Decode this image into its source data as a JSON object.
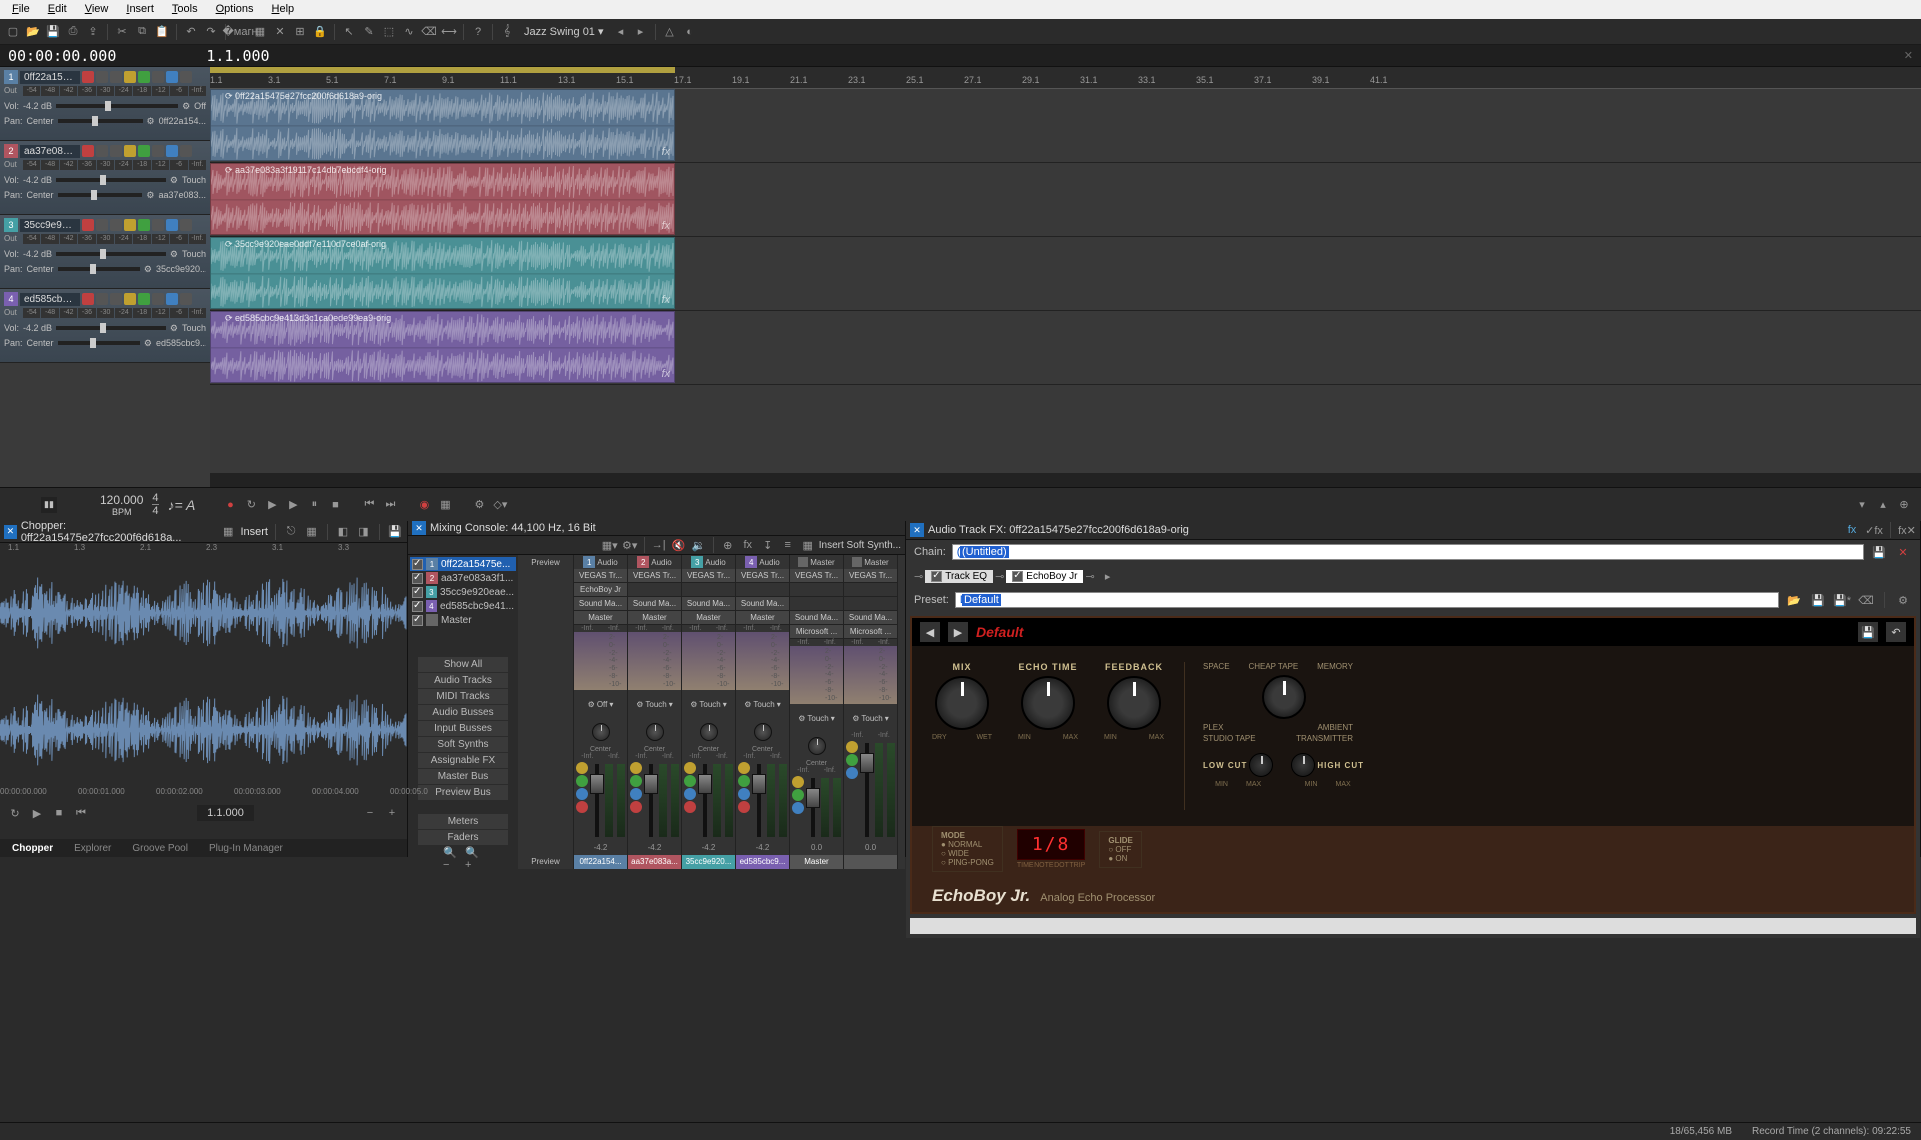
{
  "menu": [
    "File",
    "Edit",
    "View",
    "Insert",
    "Tools",
    "Options",
    "Help"
  ],
  "toolbar_dropdown": "Jazz Swing 01",
  "time": {
    "current": "00:00:00.000",
    "position": "1.1.000"
  },
  "ruler_marks": [
    "1.1",
    "3.1",
    "5.1",
    "7.1",
    "9.1",
    "11.1",
    "13.1",
    "15.1",
    "17.1",
    "19.1",
    "21.1",
    "23.1",
    "25.1",
    "27.1",
    "29.1",
    "31.1",
    "33.1",
    "35.1",
    "37.1",
    "39.1",
    "41.1"
  ],
  "meter_labels": [
    "-54",
    "-48",
    "-42",
    "-36",
    "-30",
    "-24",
    "-18",
    "-12",
    "-6",
    "-Inf."
  ],
  "tracks": [
    {
      "num": "1",
      "color": "#5a80a5",
      "name": "0ff22a1547...",
      "clip": "0ff22a15475e27fcc200f6d618a9-orig",
      "vol": "-4.2 dB",
      "pan": "Center",
      "mode": "Off",
      "out": "Out",
      "send": "0ff22a154..."
    },
    {
      "num": "2",
      "color": "#b05560",
      "name": "aa37e083a3...",
      "clip": "aa37e083a3f19117c14db7ebcdf4-orig",
      "vol": "-4.2 dB",
      "pan": "Center",
      "mode": "Touch",
      "out": "Out",
      "send": "aa37e083..."
    },
    {
      "num": "3",
      "color": "#45a0a5",
      "name": "35cc9e920e...",
      "clip": "35cc9e920eae0ddf7e110d7ce0af-orig",
      "vol": "-4.2 dB",
      "pan": "Center",
      "mode": "Touch",
      "out": "Out",
      "send": "35cc9e920..."
    },
    {
      "num": "4",
      "color": "#7a60b0",
      "name": "ed585cbc9e...",
      "clip": "ed585cbc9e413d3c1ca0ede99ea9-orig",
      "vol": "-4.2 dB",
      "pan": "Center",
      "mode": "Touch",
      "out": "Out",
      "send": "ed585cbc9..."
    }
  ],
  "transport": {
    "bpm": "120.000",
    "bpm_label": "BPM",
    "sig": "4",
    "sig2": "4"
  },
  "chopper": {
    "title": "Chopper: 0ff22a15475e27fcc200f6d618a...",
    "insert_btn": "Insert",
    "ruler_top": [
      "1.1",
      "1.3",
      "2.1",
      "2.3",
      "3.1",
      "3.3"
    ],
    "ruler_bottom": [
      "00:00:00.000",
      "00:00:01.000",
      "00:00:02.000",
      "00:00:03.000",
      "00:00:04.000",
      "00:00:05.0"
    ],
    "position": "1.1.000",
    "tabs": [
      "Chopper",
      "Explorer",
      "Groove Pool",
      "Plug-In Manager"
    ]
  },
  "mixer": {
    "title": "Mixing Console: 44,100 Hz, 16 Bit",
    "insert_label": "Insert Soft Synth...",
    "tracks": [
      {
        "num": "1",
        "name": "0ff22a15475e...",
        "color": "#5a80a5",
        "sel": true
      },
      {
        "num": "2",
        "name": "aa37e083a3f1...",
        "color": "#b05560"
      },
      {
        "num": "3",
        "name": "35cc9e920eae...",
        "color": "#45a0a5"
      },
      {
        "num": "4",
        "name": "ed585cbc9e41...",
        "color": "#7a60b0"
      },
      {
        "num": "",
        "name": "Master",
        "color": "#888"
      }
    ],
    "buttons": [
      "Show All",
      "Audio Tracks",
      "MIDI Tracks",
      "Audio Busses",
      "Input Busses",
      "Soft Synths",
      "Assignable FX",
      "Master Bus",
      "Preview Bus"
    ],
    "buttons2": [
      "Meters",
      "Faders"
    ],
    "strip_labels": {
      "preview": "Preview",
      "audio": "Audio",
      "master": "Master"
    },
    "strip_inserts": [
      "VEGAS Tr...",
      "EchoBoy Jr",
      "",
      "Sound Ma...",
      "Microsoft ...",
      "Master"
    ],
    "strip_modes": {
      "off": "Off",
      "touch": "Touch",
      "center": "Center"
    },
    "strip_db_vals": [
      "-4.2",
      "-4.2",
      "-4.2",
      "-4.2",
      "0.0",
      "0.0"
    ],
    "strip_names": [
      "0ff22a154...",
      "aa37e083a...",
      "35cc9e920...",
      "ed585cbc9...",
      "Master",
      ""
    ],
    "meter_ticks": [
      "-Inf.",
      "2-",
      "0-",
      "-2-",
      "-4-",
      "-6-",
      "-8-",
      "-10-"
    ],
    "bottom_label": "Preview"
  },
  "fx": {
    "title": "Audio Track FX: 0ff22a15475e27fcc200f6d618a9-orig",
    "chain_label": "Chain:",
    "chain_value": "(Untitled)",
    "chain_items": [
      "Track EQ",
      "EchoBoy Jr"
    ],
    "preset_label": "Preset:",
    "preset_value": "Default",
    "plugin": {
      "preset": "Default",
      "knobs": [
        {
          "label": "MIX",
          "left": "DRY",
          "right": "WET"
        },
        {
          "label": "ECHO TIME",
          "left": "MIN",
          "right": "MAX"
        },
        {
          "label": "FEEDBACK",
          "left": "MIN",
          "right": "MAX"
        }
      ],
      "right_labels_top": [
        "SPACE",
        "CHEAP TAPE",
        "MEMORY"
      ],
      "right_labels_mid": [
        "PLEX",
        "AMBIENT"
      ],
      "right_labels_bot": [
        "STUDIO TAPE",
        "TRANSMITTER"
      ],
      "mode_label": "MODE",
      "modes": [
        "NORMAL",
        "WIDE",
        "PING-PONG"
      ],
      "time_labels": [
        "TIME",
        "NOTE",
        "DOT",
        "TRIP"
      ],
      "lcd": "1/8",
      "glide_label": "GLIDE",
      "glide_opts": [
        "OFF",
        "ON"
      ],
      "small_knobs": [
        {
          "label": "LOW CUT",
          "left": "MIN",
          "right": "MAX"
        },
        {
          "label": "HIGH CUT",
          "left": "MIN",
          "right": "MAX"
        }
      ],
      "name": "EchoBoy Jr.",
      "sub": "Analog Echo Processor"
    }
  },
  "status": {
    "mem": "18/65,456 MB",
    "rec": "Record Time (2 channels): 09:22:55"
  }
}
